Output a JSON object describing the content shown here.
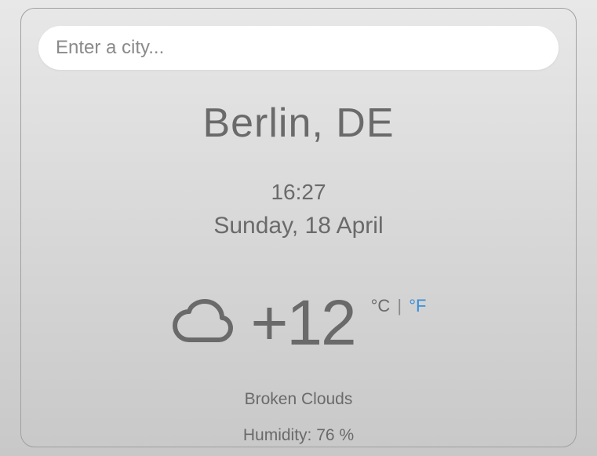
{
  "search": {
    "placeholder": "Enter a city...",
    "value": ""
  },
  "city": "Berlin, DE",
  "time": "16:27",
  "date": "Sunday, 18 April",
  "temperature": "+12",
  "units": {
    "celsius": "°C",
    "separator": "|",
    "fahrenheit": "°F"
  },
  "condition": "Broken Clouds",
  "humidity_label": "Humidity:",
  "humidity_value": "76 %",
  "icon": "cloud"
}
